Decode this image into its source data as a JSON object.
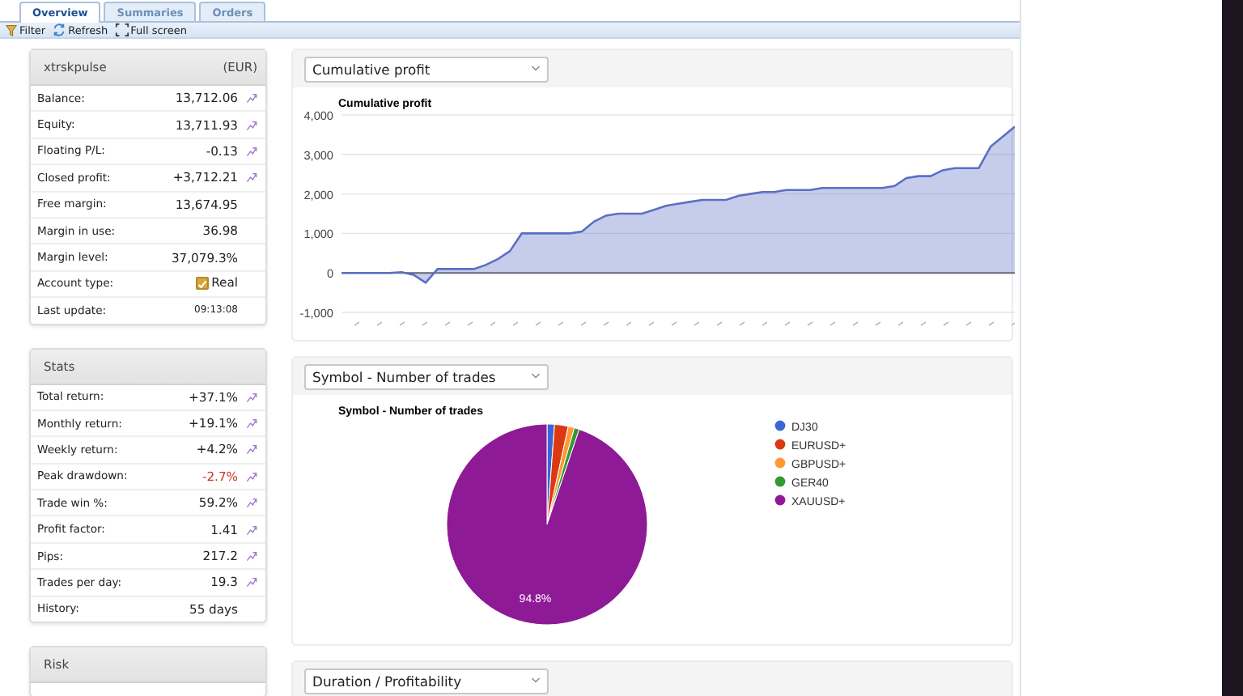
{
  "tabs": [
    {
      "label": "Overview",
      "selected": true
    },
    {
      "label": "Summaries",
      "selected": false
    },
    {
      "label": "Orders",
      "selected": false
    }
  ],
  "toolbar": [
    {
      "kind": "filter",
      "label": "Filter"
    },
    {
      "kind": "refresh",
      "label": "Refresh"
    },
    {
      "kind": "fullscreen",
      "label": "Full screen"
    }
  ],
  "account": {
    "title": "xtrskpulse",
    "currency": "(EUR)",
    "rows": [
      {
        "label": "Balance:",
        "value": "13,712.06",
        "kind": "text",
        "chart_link": true
      },
      {
        "label": "Equity:",
        "value": "13,711.93",
        "kind": "text",
        "chart_link": true
      },
      {
        "label": "Floating P/L:",
        "value": "-0.13",
        "kind": "text",
        "chart_link": true
      },
      {
        "label": "Closed profit:",
        "value": "+3,712.21",
        "kind": "text",
        "chart_link": true
      },
      {
        "label": "Free margin:",
        "value": "13,674.95",
        "kind": "text",
        "chart_link": false
      },
      {
        "label": "Margin in use:",
        "value": "36.98",
        "kind": "text",
        "chart_link": false
      },
      {
        "label": "Margin level:",
        "value": "37,079.3%",
        "kind": "text",
        "chart_link": false
      },
      {
        "label": "Account type:",
        "value": "Real",
        "kind": "checkbox",
        "checked": true,
        "chart_link": false
      },
      {
        "label": "Last update:",
        "value": "09:13:08",
        "kind": "small",
        "chart_link": false
      }
    ]
  },
  "stats": {
    "title": "Stats",
    "rows": [
      {
        "label": "Total return:",
        "value": "+37.1%",
        "kind": "text",
        "chart_link": true
      },
      {
        "label": "Monthly return:",
        "value": "+19.1%",
        "kind": "text",
        "chart_link": true
      },
      {
        "label": "Weekly return:",
        "value": "+4.2%",
        "kind": "text",
        "chart_link": true
      },
      {
        "label": "Peak drawdown:",
        "value": "-2.7%",
        "kind": "negative",
        "chart_link": true
      },
      {
        "label": "Trade win %:",
        "value": "59.2%",
        "kind": "text",
        "chart_link": true
      },
      {
        "label": "Profit factor:",
        "value": "1.41",
        "kind": "text",
        "chart_link": true
      },
      {
        "label": "Pips:",
        "value": "217.2",
        "kind": "text",
        "chart_link": true
      },
      {
        "label": "Trades per day:",
        "value": "19.3",
        "kind": "text",
        "chart_link": true
      },
      {
        "label": "History:",
        "value": "55 days",
        "kind": "text",
        "chart_link": false
      }
    ]
  },
  "risk": {
    "title": "Risk"
  },
  "charts": [
    {
      "select": "Cumulative profit",
      "chart_data": {
        "type": "area",
        "title": "Cumulative profit",
        "grid": true,
        "ylim": [
          -1000,
          4000
        ],
        "yticks": [
          {
            "value": -1000,
            "label": "-1,000"
          },
          {
            "value": 0,
            "label": "0"
          },
          {
            "value": 1000,
            "label": "1,000"
          },
          {
            "value": 2000,
            "label": "2,000"
          },
          {
            "value": 3000,
            "label": "3,000"
          },
          {
            "value": 4000,
            "label": "4,000"
          }
        ],
        "values": [
          0,
          0,
          0,
          0,
          0,
          20,
          -50,
          -250,
          100,
          100,
          100,
          100,
          200,
          350,
          550,
          1000,
          1000,
          1000,
          1000,
          1000,
          1050,
          1300,
          1450,
          1500,
          1500,
          1500,
          1600,
          1700,
          1750,
          1800,
          1850,
          1850,
          1850,
          1950,
          2000,
          2050,
          2050,
          2100,
          2100,
          2100,
          2150,
          2150,
          2150,
          2150,
          2150,
          2150,
          2200,
          2400,
          2450,
          2450,
          2600,
          2650,
          2650,
          2650,
          3200,
          3450,
          3700
        ]
      }
    },
    {
      "select": "Symbol - Number of trades",
      "chart_data": {
        "type": "pie",
        "title": "Symbol - Number of trades",
        "categories": [
          "DJ30",
          "EURUSD+",
          "GBPUSD+",
          "GER40",
          "XAUUSD+"
        ],
        "values": [
          1.2,
          2.2,
          1.0,
          0.8,
          94.8
        ],
        "colors": [
          "#3b64d6",
          "#dc3912",
          "#ff9933",
          "#339933",
          "#8e1a96"
        ],
        "legend": "right",
        "value_labels": [
          null,
          null,
          null,
          null,
          "94.8%"
        ]
      }
    },
    {
      "select": "Duration / Profitability"
    }
  ]
}
